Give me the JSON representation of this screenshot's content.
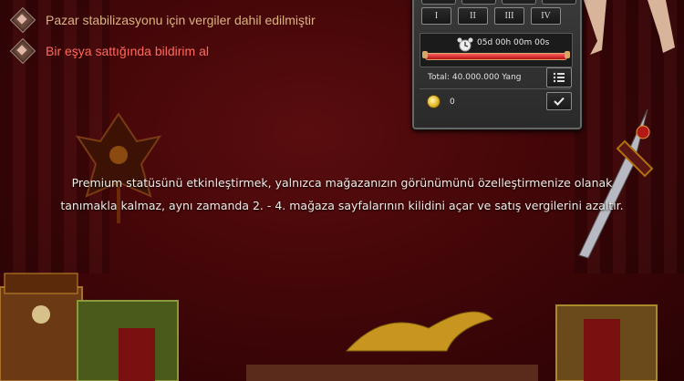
{
  "features": [
    {
      "text": "Pazar stabilizasyonu için vergiler dahil edilmiştir",
      "color": "#d9b47f"
    },
    {
      "text": "Bir eşya sattığında bildirim al",
      "color": "#ff6a5c"
    }
  ],
  "panel": {
    "page_tabs": [
      "I",
      "II",
      "III",
      "IV"
    ],
    "timer": "05d 00h 00m 00s",
    "timer_progress": 1.0,
    "total": "Total: 40.000.000 Yang",
    "coin_value": "0"
  },
  "description": {
    "line1": "Premium statüsünü etkinleştirmek, yalnızca mağazanızın görünümünü özelleştirmenize olanak",
    "line2": "tanımakla kalmaz, aynı zamanda 2. - 4. mağaza sayfalarının kilidini açar ve satış vergilerini azaltır."
  },
  "icons": {
    "feature_bullet": "diamond-bullet-icon",
    "timer": "alarm-clock-icon",
    "list": "list-icon",
    "currency": "gold-coin-icon",
    "confirm": "checkmark-icon"
  }
}
